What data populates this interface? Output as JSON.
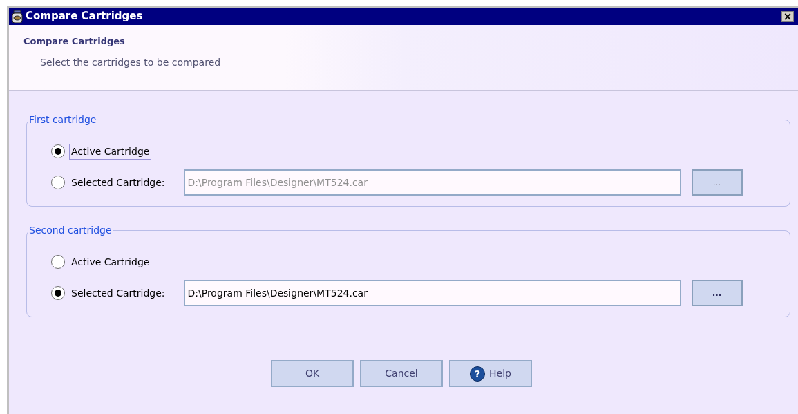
{
  "window": {
    "title": "Compare Cartridges",
    "close": "×"
  },
  "header": {
    "title": "Compare Cartridges",
    "subtitle": "Select the cartridges to be compared"
  },
  "groups": [
    {
      "title": "First cartridge",
      "options": [
        {
          "label": "Active Cartridge",
          "selected": true,
          "focused": true
        },
        {
          "label": "Selected Cartridge:",
          "selected": false,
          "focused": false
        }
      ],
      "path": {
        "value": "D:\\Program Files\\Designer\\MT524.car",
        "disabled": true
      },
      "browse": {
        "label": "...",
        "disabled": true
      }
    },
    {
      "title": "Second cartridge",
      "options": [
        {
          "label": "Active Cartridge",
          "selected": false,
          "focused": false
        },
        {
          "label": "Selected Cartridge:",
          "selected": true,
          "focused": false
        }
      ],
      "path": {
        "value": "D:\\Program Files\\Designer\\MT524.car",
        "disabled": false
      },
      "browse": {
        "label": "...",
        "disabled": false
      }
    }
  ],
  "buttons": [
    {
      "label": "OK",
      "kind": "plain"
    },
    {
      "label": "Cancel",
      "kind": "plain"
    },
    {
      "label": "Help",
      "kind": "help",
      "icon": "?"
    }
  ]
}
